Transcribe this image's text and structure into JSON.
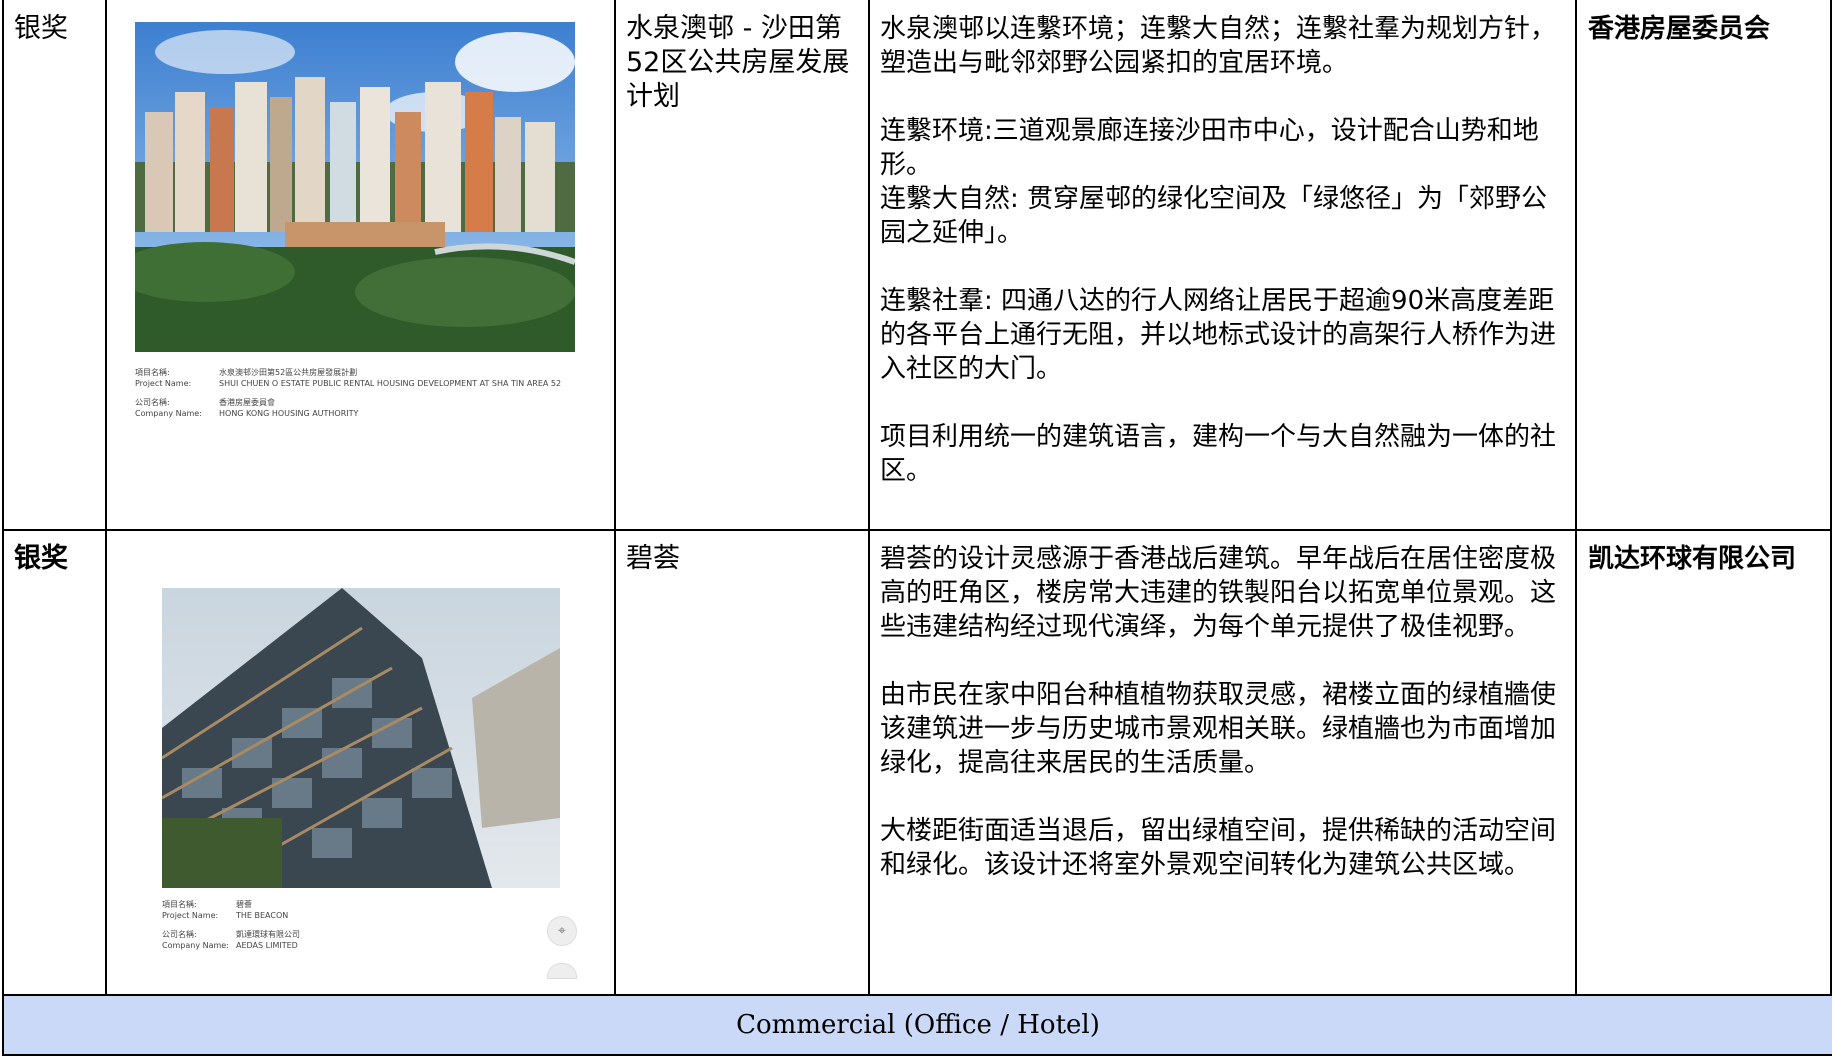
{
  "rows": [
    {
      "award": "银奖",
      "project": "水泉澳邨 - 沙田第52区公共房屋发展计划",
      "description": [
        "水泉澳邨以连繫环境；连繫大自然；连繫社羣为规划方针，塑造出与毗邻郊野公园紧扣的宜居环境。",
        "连繫环境:三道观景廊连接沙田市中心，设计配合山势和地形。\n连繫大自然: 贯穿屋邨的绿化空间及「绿悠径」为「郊野公园之延伸」。",
        "连繫社羣: 四通八达的行人网络让居民于超逾90米高度差距的各平台上通行无阻，并以地标式设计的高架行人桥作为进入社区的大门。",
        "项目利用统一的建筑语言，建构一个与大自然融为一体的社区。"
      ],
      "company": "香港房屋委员会",
      "caption": {
        "project_label": "項目名稱:\nProject Name:",
        "project_value": "水泉澳邨沙田第52區公共房屋發展計劃\nSHUI CHUEN O ESTATE PUBLIC RENTAL HOUSING DEVELOPMENT AT SHA TIN AREA 52",
        "company_label": "公司名稱:\nCompany Name:",
        "company_value": "香港房屋委員會\nHONG KONG HOUSING AUTHORITY"
      }
    },
    {
      "award": "银奖",
      "project": "碧荟",
      "description": [
        "碧荟的设计灵感源于香港战后建筑。早年战后在居住密度极高的旺角区，楼房常大违建的铁製阳台以拓宽单位景观。这些违建结构经过现代演绎，为每个单元提供了极佳视野。",
        "由市民在家中阳台种植植物获取灵感，裙楼立面的绿植牆使该建筑进一步与历史城市景观相关联。绿植牆也为市面增加绿化，提高往来居民的生活质量。",
        "大楼距街面适当退后，留出绿植空间，提供稀缺的活动空间和绿化。该设计还将室外景观空间转化为建筑公共区域。"
      ],
      "company": "凯达环球有限公司",
      "caption": {
        "project_label": "項目名稱:\nProject Name:",
        "project_value": "碧薈\nTHE BEACON",
        "company_label": "公司名稱:\nCompany Name:",
        "company_value": "凱達環球有限公司\nAEDAS LIMITED"
      }
    }
  ],
  "footer": "Commercial (Office / Hotel)",
  "icons": {
    "viewer_control": "fit-screen-icon"
  },
  "colors": {
    "footer_bg": "#c9d9f7",
    "border": "#000000"
  }
}
